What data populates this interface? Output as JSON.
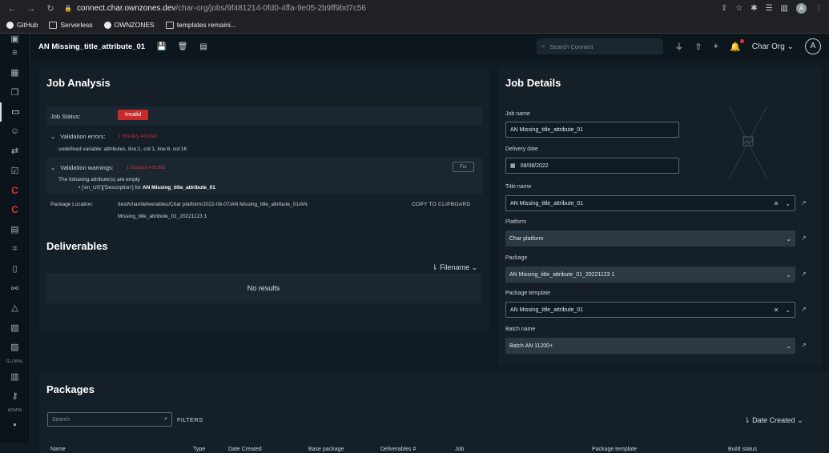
{
  "browser": {
    "url_host": "connect.char.ownzones.dev",
    "url_path": "/char-org/jobs/9f481214-0fd0-4ffa-9e05-2b9ff9bd7c56",
    "avatar_letter": "A",
    "bookmarks": [
      "GitHub",
      "Serverless",
      "OWNZONES",
      "templates remaini..."
    ]
  },
  "topbar": {
    "job_name": "AN Missing_title_attribute_01",
    "search_placeholder": "Search Connect",
    "org_name": "Char Org",
    "avatar_letter": "A"
  },
  "sidebar": {
    "global_label": "GLOBAL",
    "admin_label": "ADMIN",
    "brand_letter": "C"
  },
  "analysis": {
    "title": "Job Analysis",
    "status_label": "Job Status:",
    "status_value": "Invalid",
    "errors_label": "Validation errors:",
    "errors_count": "1 ISSUES FOUND",
    "error_text": "undefined variable: attributes, line:1, col:1, line:8, col:16",
    "warnings_label": "Validation warnings:",
    "warnings_count": "1 ISSUES FOUND",
    "fix_label": "Fix",
    "warning_text": "The following attribute(s) are empty",
    "warning_item_prefix": "['en_US']['Description'] for",
    "warning_item_bold": "AN Missing_title_attribute_01",
    "package_location_label": "Package Location:",
    "package_location_line1": "/test/char/deliverables/Char platform/2022-08-07/AN Missing_title_attribute_01/AN",
    "package_location_line2": "Missing_title_attribute_01_20221123 1",
    "copy_label": "COPY TO CLIPBOARD"
  },
  "deliverables": {
    "title": "Deliverables",
    "sort_label": "Filename",
    "empty_text": "No results"
  },
  "details": {
    "title": "Job Details",
    "job_name_label": "Job name",
    "job_name_value": "AN Missing_title_attribute_01",
    "delivery_date_label": "Delivery date",
    "delivery_date_value": "08/08/2022",
    "title_name_label": "Title name",
    "title_name_value": "AN Missing_title_attribute_01",
    "platform_label": "Platform",
    "platform_value": "Char platform",
    "package_label": "Package",
    "package_value": "AN Missing_title_attribute_01_20221123 1",
    "package_template_label": "Package template",
    "package_template_value": "AN Missing_title_attribute_01",
    "batch_name_label": "Batch name",
    "batch_name_value": "Batch AN 11200+"
  },
  "packages": {
    "title": "Packages",
    "search_placeholder": "Search",
    "filters_label": "FILTERS",
    "sort_label": "Date Created",
    "columns": [
      "Name",
      "Type",
      "Date Created",
      "Base package",
      "Deliverables #",
      "Job",
      "Package template",
      "Build status"
    ]
  }
}
